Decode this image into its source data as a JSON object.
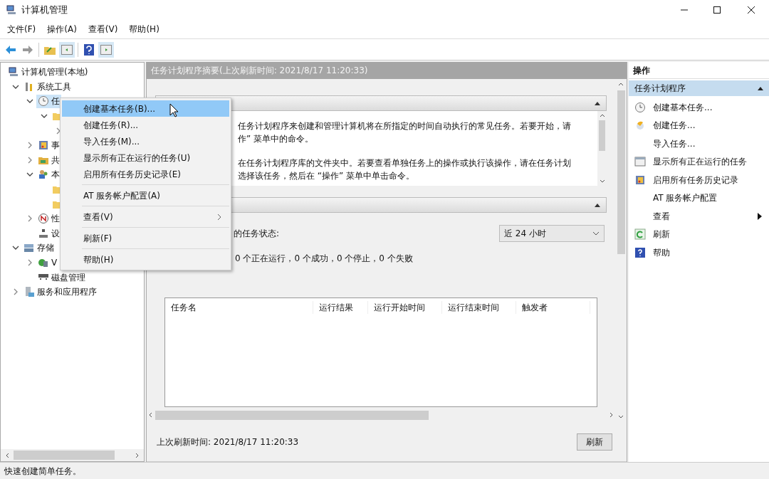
{
  "window": {
    "title": "计算机管理"
  },
  "menubar": [
    "文件(F)",
    "操作(A)",
    "查看(V)",
    "帮助(H)"
  ],
  "tree": [
    {
      "label": "计算机管理(本地)",
      "selected": false,
      "children": [
        {
          "label": "系统工具",
          "expanded": true,
          "selected": false,
          "children": [
            {
              "label": "任",
              "expanded": true,
              "selected": true,
              "children": [
                {
                  "expanded": true,
                  "selected": false,
                  "children": [
                    {
                      "expanded": false,
                      "selected": false
                    }
                  ]
                }
              ]
            },
            {
              "label": "事",
              "expanded": false,
              "selected": false
            },
            {
              "label": "共",
              "expanded": false,
              "selected": false
            },
            {
              "label": "本",
              "expanded": true,
              "selected": false,
              "children": [
                {
                  "selected": false
                },
                {
                  "selected": false
                }
              ]
            },
            {
              "label": "性",
              "expanded": false,
              "selected": false
            },
            {
              "label": "设",
              "selected": false
            }
          ]
        },
        {
          "label": "存储",
          "expanded": true,
          "selected": false,
          "children": [
            {
              "label": "V",
              "expanded": false,
              "selected": false
            },
            {
              "label": "磁盘管理",
              "selected": false
            }
          ]
        },
        {
          "label": "服务和应用程序",
          "expanded": false,
          "selected": false
        }
      ]
    }
  ],
  "center": {
    "title": "任务计划程序摘要(上次刷新时间: 2021/8/17 11:20:33)",
    "overview_paragraphs": [
      [
        "任务计划程序来创建和管理计算机将在所指定的时间自动执行的常见任务。若要开始，请",
        "作” 菜单中的命令。"
      ],
      [
        "在任务计划程序库的文件夹中。若要查看单独任务上的操作或执行该操作，请在任务计划",
        "选择该任务，然后在 “操作” 菜单中单击命令。"
      ]
    ],
    "status_label": "的任务状态:",
    "period": "近 24 小时",
    "summary": "0 个正在运行，0 个成功，0 个停止，0 个失败",
    "table": {
      "columns": [
        "任务名",
        "运行结果",
        "运行开始时间",
        "运行结束时间",
        "触发者"
      ]
    },
    "last_refresh": "上次刷新时间: 2021/8/17 11:20:33",
    "refresh_button": "刷新"
  },
  "context_menu": [
    {
      "kind": "item",
      "label": "创建基本任务(B)...",
      "selected": true
    },
    {
      "kind": "item",
      "label": "创建任务(R)...",
      "selected": false
    },
    {
      "kind": "item",
      "label": "导入任务(M)...",
      "selected": false
    },
    {
      "kind": "item",
      "label": "显示所有正在运行的任务(U)",
      "selected": false
    },
    {
      "kind": "item",
      "label": "启用所有任务历史记录(E)",
      "selected": false
    },
    {
      "kind": "separator"
    },
    {
      "kind": "item",
      "label": "AT 服务帐户配置(A)",
      "selected": false
    },
    {
      "kind": "separator"
    },
    {
      "kind": "submenu",
      "label": "查看(V)",
      "selected": false
    },
    {
      "kind": "separator"
    },
    {
      "kind": "item",
      "label": "刷新(F)",
      "selected": false
    },
    {
      "kind": "separator"
    },
    {
      "kind": "item",
      "label": "帮助(H)",
      "selected": false
    }
  ],
  "actions": {
    "title": "操作",
    "group": {
      "label": "任务计划程序",
      "expanded": true
    },
    "items": [
      {
        "label": "创建基本任务...",
        "submenu": false
      },
      {
        "label": "创建任务...",
        "submenu": false
      },
      {
        "label": "导入任务...",
        "submenu": false
      },
      {
        "label": "显示所有正在运行的任务",
        "submenu": false
      },
      {
        "label": "启用所有任务历史记录",
        "submenu": false
      },
      {
        "label": "AT 服务帐户配置",
        "submenu": false
      },
      {
        "label": "查看",
        "submenu": true
      },
      {
        "label": "刷新",
        "submenu": false
      },
      {
        "label": "帮助",
        "submenu": false
      }
    ]
  },
  "status_bar": "快速创建简单任务。"
}
